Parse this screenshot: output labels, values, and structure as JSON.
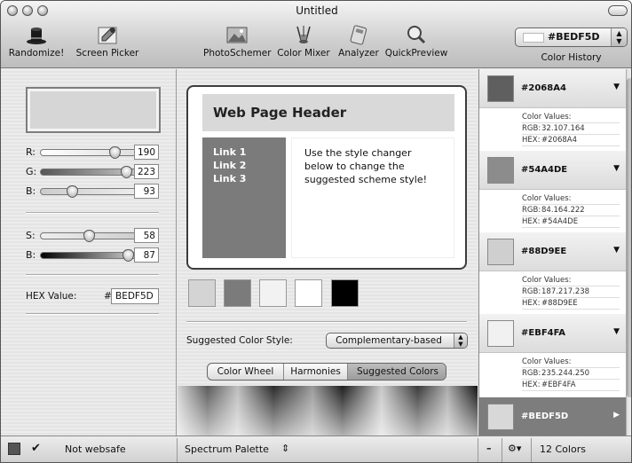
{
  "window": {
    "title": "Untitled"
  },
  "toolbar": {
    "randomize": "Randomize!",
    "screen_picker": "Screen Picker",
    "photo_schemer": "PhotoSchemer",
    "color_mixer": "Color Mixer",
    "analyzer": "Analyzer",
    "quick_preview": "QuickPreview",
    "history_value": "#BEDF5D",
    "history_label": "Color History"
  },
  "sliders": {
    "r": {
      "label": "R:",
      "value": "190"
    },
    "g": {
      "label": "G:",
      "value": "223"
    },
    "b": {
      "label": "B:",
      "value": "93"
    },
    "s": {
      "label": "S:",
      "value": "58"
    },
    "br": {
      "label": "B:",
      "value": "87"
    }
  },
  "hex": {
    "label": "HEX Value:",
    "hash": "#",
    "value": "BEDF5D"
  },
  "preview": {
    "header": "Web Page Header",
    "links": [
      "Link 1",
      "Link 2",
      "Link 3"
    ],
    "body": "Use the style changer below to change the suggested scheme style!"
  },
  "swatch_colors": [
    "#d4d4d4",
    "#7b7b7b",
    "#f2f2f2",
    "#ffffff",
    "#000000"
  ],
  "style": {
    "label": "Suggested Color Style:",
    "value": "Complementary-based"
  },
  "tabs": [
    "Color Wheel",
    "Harmonies",
    "Suggested Colors"
  ],
  "history": [
    {
      "code": "#2068A4",
      "color": "#5f5f5f",
      "values_label": "Color Values:",
      "rgb": "32.107.164",
      "hex": "#2068A4"
    },
    {
      "code": "#54A4DE",
      "color": "#8c8c8c",
      "values_label": "Color Values:",
      "rgb": "84.164.222",
      "hex": "#54A4DE"
    },
    {
      "code": "#88D9EE",
      "color": "#cfcfcf",
      "values_label": "Color Values:",
      "rgb": "187.217.238",
      "hex": "#88D9EE"
    },
    {
      "code": "#EBF4FA",
      "color": "#f1f1f1",
      "values_label": "Color Values:",
      "rgb": "235.244.250",
      "hex": "#EBF4FA"
    },
    {
      "code": "#BEDF5D",
      "color": "#d8d8d8"
    }
  ],
  "labels": {
    "rgb": "RGB:",
    "hex": "HEX:"
  },
  "status": {
    "websafe": "Not websafe",
    "palette": "Spectrum Palette",
    "palette_arrows": "⇕",
    "minus": "–",
    "gear": "⚙▾",
    "count": "12 Colors"
  }
}
